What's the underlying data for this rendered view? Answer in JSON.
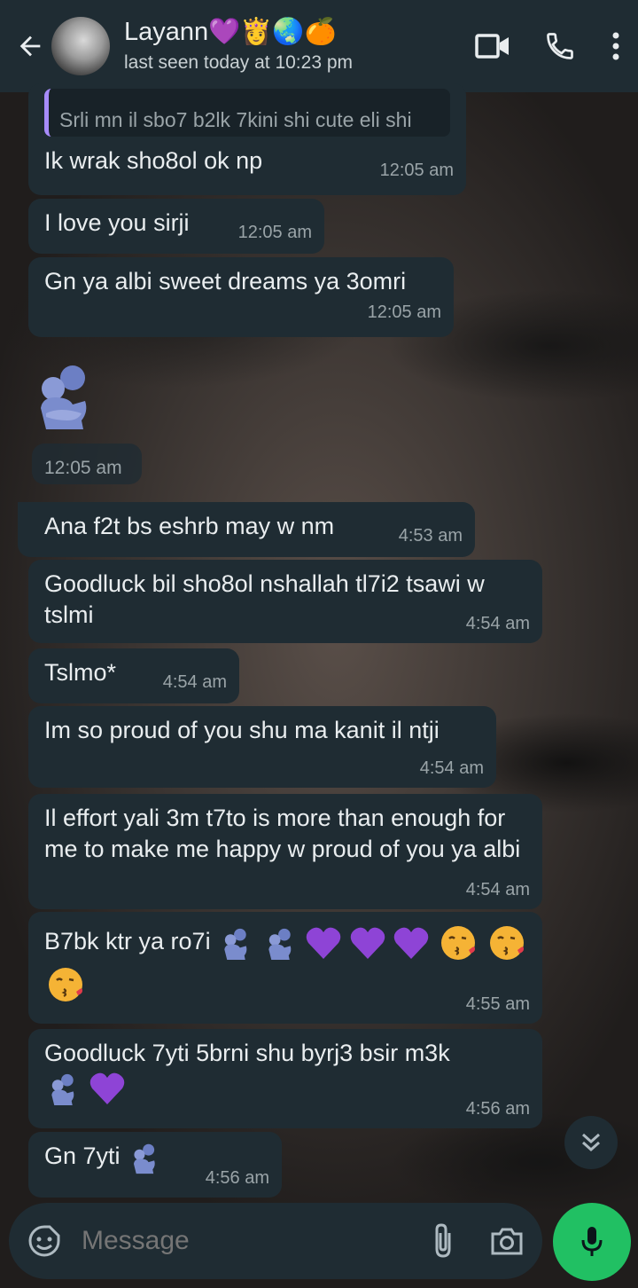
{
  "header": {
    "name": "Layann💜👸🌏🍊",
    "status": "last seen today at 10:23 pm"
  },
  "messages": [
    {
      "quote": "Srli mn il sbo7 b2lk 7kini shi cute eli shi",
      "text": "Ik wrak sho8ol ok np",
      "time": "12:05 am"
    },
    {
      "text": "I love you sirji",
      "time": "12:05 am"
    },
    {
      "text": "Gn ya albi sweet dreams ya 3omri",
      "time": "12:05 am"
    },
    {
      "emoji": "people-hugging",
      "time": "12:05 am"
    },
    {
      "text": "Ana f2t bs eshrb may w nm",
      "time": "4:53 am"
    },
    {
      "text": "Goodluck bil sho8ol nshallah tl7i2 tsawi w tslmi",
      "time": "4:54 am"
    },
    {
      "text": "Tslmo*",
      "time": "4:54 am"
    },
    {
      "text": "Im so proud of you shu ma kanit il ntji",
      "time": "4:54 am"
    },
    {
      "text": "Il effort yali 3m t7to is more than enough for me to make me happy w proud of you ya albi",
      "time": "4:54 am"
    },
    {
      "text": "B7bk ktr ya ro7i",
      "time": "4:55 am"
    },
    {
      "text": "Goodluck 7yti 5brni shu byrj3 bsir m3k",
      "time": "4:56 am"
    },
    {
      "text": "Gn 7yti",
      "time": "4:56 am"
    }
  ],
  "composer": {
    "placeholder": "Message"
  },
  "colors": {
    "header_bg": "#1f2c33",
    "bubble_bg": "#1f2c33",
    "accent_green": "#21c063",
    "quote_bar": "#a78bfa"
  }
}
